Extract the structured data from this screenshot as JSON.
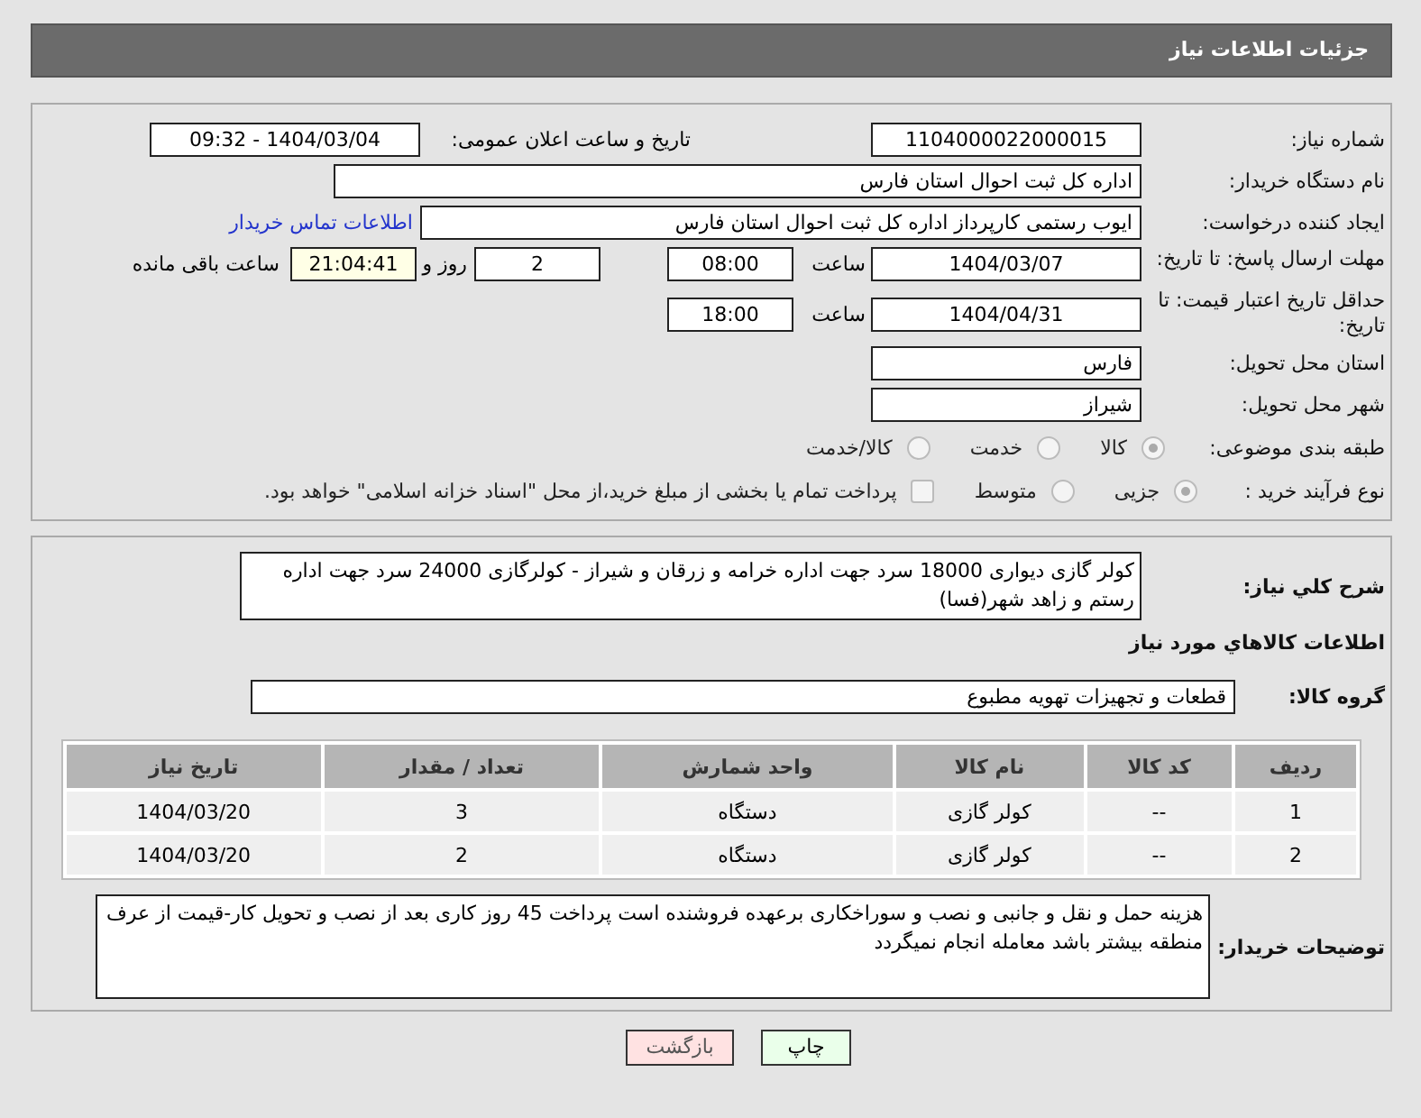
{
  "header": {
    "title": "جزئیات اطلاعات نیاز"
  },
  "need_number": {
    "label": "شماره نیاز:",
    "value": "1104000022000015"
  },
  "announce": {
    "label": "تاریخ و ساعت اعلان عمومی:",
    "value": "1404/03/04 - 09:32"
  },
  "buyer": {
    "label": "نام دستگاه خریدار:",
    "value": "اداره کل ثبت احوال استان فارس"
  },
  "requester": {
    "label": "ایجاد کننده درخواست:",
    "value": "ایوب رستمی کارپرداز اداره کل ثبت احوال استان فارس",
    "link": "اطلاعات تماس خریدار"
  },
  "reply_deadline": {
    "label": "مهلت ارسال پاسخ: تا تاریخ:",
    "date": "1404/03/07",
    "time_label": "ساعت",
    "time": "08:00",
    "days": "2",
    "days_label": "روز و",
    "remaining": "21:04:41",
    "remaining_label": "ساعت باقی مانده"
  },
  "price_validity": {
    "label": "حداقل تاریخ اعتبار قیمت: تا تاریخ:",
    "date": "1404/04/31",
    "time_label": "ساعت",
    "time": "18:00"
  },
  "province": {
    "label": "استان محل تحویل:",
    "value": "فارس"
  },
  "city": {
    "label": "شهر محل تحویل:",
    "value": "شیراز"
  },
  "category": {
    "label": "طبقه بندی موضوعی:",
    "options": [
      {
        "label": "کالا",
        "selected": true
      },
      {
        "label": "خدمت",
        "selected": false
      },
      {
        "label": "کالا/خدمت",
        "selected": false
      }
    ]
  },
  "process": {
    "label": "نوع فرآیند خرید :",
    "options": [
      {
        "label": "جزیی",
        "selected": true
      },
      {
        "label": "متوسط",
        "selected": false
      }
    ],
    "treasury": {
      "label": "پرداخت تمام یا بخشی از مبلغ خرید،از محل \"اسناد خزانه اسلامی\" خواهد بود.",
      "checked": false
    }
  },
  "description": {
    "label": "شرح کلي نیاز:",
    "value": "کولر گازی دیواری 18000 سرد جهت اداره خرامه و زرقان و شیراز - کولرگازی 24000 سرد جهت اداره رستم و زاهد شهر(فسا)"
  },
  "goods_heading": "اطلاعات کالاهاي مورد نیاز",
  "goods_group": {
    "label": "گروه کالا:",
    "value": "قطعات و تجهیزات تهویه مطبوع"
  },
  "table": {
    "columns": [
      "ردیف",
      "کد کالا",
      "نام کالا",
      "واحد شمارش",
      "تعداد / مقدار",
      "تاریخ نیاز"
    ],
    "rows": [
      [
        "1",
        "--",
        "کولر گازی",
        "دستگاه",
        "3",
        "1404/03/20"
      ],
      [
        "2",
        "--",
        "کولر گازی",
        "دستگاه",
        "2",
        "1404/03/20"
      ]
    ]
  },
  "buyer_notes": {
    "label": "توضیحات خریدار:",
    "value": "هزینه حمل و نقل و جانبی و نصب و سوراخکاری برعهده فروشنده است پرداخت 45 روز کاری بعد از نصب و تحویل کار-قیمت از عرف منطقه بیشتر باشد معامله انجام نمیگردد"
  },
  "buttons": [
    {
      "label": "چاپ",
      "kind": "print"
    },
    {
      "label": "بازگشت",
      "kind": "back"
    }
  ]
}
